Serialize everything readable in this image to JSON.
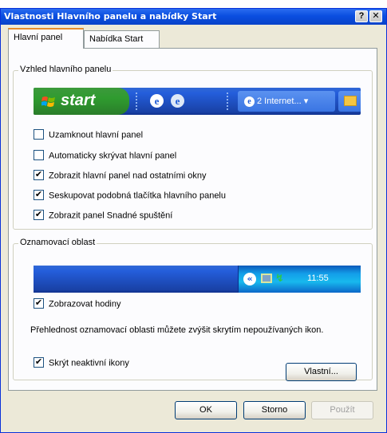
{
  "window": {
    "title": "Vlastnosti Hlavního panelu a nabídky Start",
    "help_button": "?",
    "close_button": "✕"
  },
  "tabs": [
    {
      "label": "Hlavní panel",
      "active": true
    },
    {
      "label": "Nabídka Start",
      "active": false
    }
  ],
  "taskbar_group": {
    "title": "Vzhled hlavního panelu",
    "preview": {
      "start_label": "start",
      "task_label": "2 Internet...",
      "task_arrow": "▾"
    },
    "options": [
      {
        "label": "Uzamknout hlavní panel",
        "checked": false
      },
      {
        "label": "Automaticky skrývat hlavní panel",
        "checked": false
      },
      {
        "label": "Zobrazit hlavní panel nad ostatními okny",
        "checked": true
      },
      {
        "label": "Seskupovat podobná tlačítka hlavního panelu",
        "checked": true
      },
      {
        "label": "Zobrazit panel Snadné spuštění",
        "checked": true
      }
    ]
  },
  "notification_group": {
    "title": "Oznamovací oblast",
    "preview": {
      "expand_glyph": "«",
      "clock": "11:55"
    },
    "show_clock": {
      "label": "Zobrazovat hodiny",
      "checked": true
    },
    "description": "Přehlednost oznamovací oblasti můžete zvýšit skrytím nepoužívaných ikon.",
    "hide_inactive": {
      "label": "Skrýt neaktivní ikony",
      "checked": true
    },
    "customize_button": "Vlastní..."
  },
  "buttons": {
    "ok": "OK",
    "cancel": "Storno",
    "apply": "Použít",
    "apply_enabled": false
  },
  "colors": {
    "titlebar": "#0a4ee0",
    "taskbar": "#245edb",
    "start_button": "#2f9b2f",
    "tray": "#139ee9"
  },
  "icons": [
    "help-icon",
    "close-icon",
    "windows-logo-icon",
    "ie-icon",
    "ie-updater-icon",
    "folder-icon",
    "expand-tray-icon",
    "network-icon",
    "sync-arrow-icon"
  ]
}
